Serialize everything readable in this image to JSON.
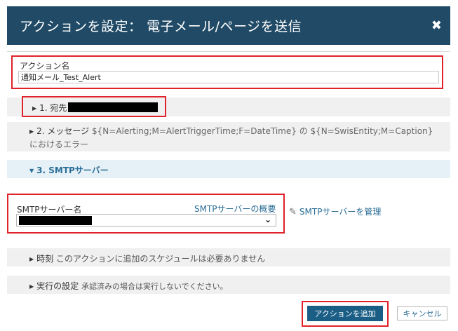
{
  "dialog": {
    "title": "アクションを設定： 電子メール/ページを送信",
    "close_icon": "close-icon",
    "close_glyph": "✖"
  },
  "action_name": {
    "label": "アクション名",
    "value": "通知メール_Test_Alert"
  },
  "sections": {
    "recipients": {
      "label": "1. 宛先",
      "expanded": false
    },
    "message": {
      "label": "2. メッセージ",
      "format": "${N=Alerting;M=AlertTriggerTime;F=DateTime} の ${N=SwisEntity;M=Caption} におけるエラー",
      "expanded": false
    },
    "smtp": {
      "label": "3. SMTPサーバー",
      "expanded": true
    },
    "time": {
      "label": "時刻",
      "note": "このアクションに追加のスケジュールは必要ありません",
      "expanded": false
    },
    "execution": {
      "label": "実行の設定",
      "note": "承認済みの場合は実行しないでください。",
      "expanded": false
    }
  },
  "smtp_server": {
    "label": "SMTPサーバー名",
    "overview_link": "SMTPサーバーの概要",
    "manage_link": "SMTPサーバーを管理",
    "select_icon": "chevron-down-icon",
    "manage_icon": "pencil-icon"
  },
  "footer": {
    "add_button": "アクションを追加",
    "cancel_button": "キャンセル"
  },
  "colors": {
    "header_bg": "#204a66",
    "accent": "#2a6d96",
    "highlight": "#e0222a",
    "section_bg": "#f0f0f0",
    "expanded_bg": "#e6f1f7",
    "primary_button": "#1a5e86"
  }
}
